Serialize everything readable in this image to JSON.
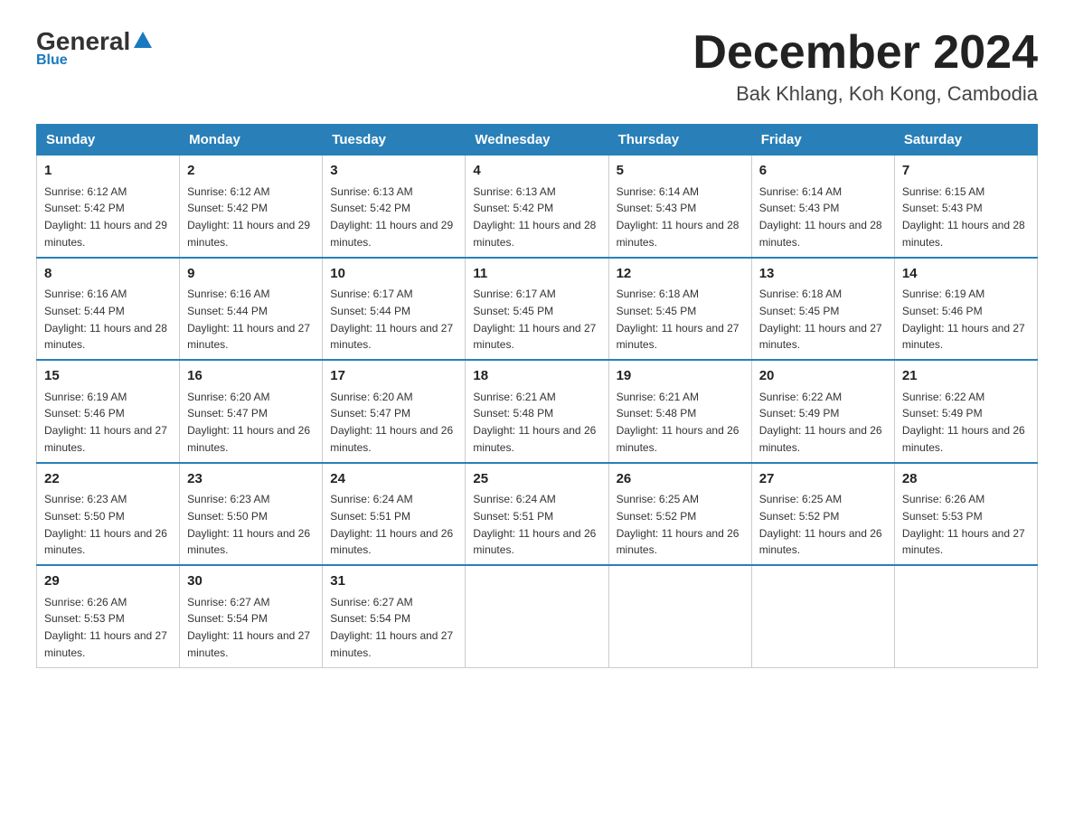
{
  "header": {
    "logo_general": "General",
    "logo_blue": "Blue",
    "month_title": "December 2024",
    "location": "Bak Khlang, Koh Kong, Cambodia"
  },
  "weekdays": [
    "Sunday",
    "Monday",
    "Tuesday",
    "Wednesday",
    "Thursday",
    "Friday",
    "Saturday"
  ],
  "weeks": [
    [
      {
        "day": "1",
        "sunrise": "6:12 AM",
        "sunset": "5:42 PM",
        "daylight": "11 hours and 29 minutes."
      },
      {
        "day": "2",
        "sunrise": "6:12 AM",
        "sunset": "5:42 PM",
        "daylight": "11 hours and 29 minutes."
      },
      {
        "day": "3",
        "sunrise": "6:13 AM",
        "sunset": "5:42 PM",
        "daylight": "11 hours and 29 minutes."
      },
      {
        "day": "4",
        "sunrise": "6:13 AM",
        "sunset": "5:42 PM",
        "daylight": "11 hours and 28 minutes."
      },
      {
        "day": "5",
        "sunrise": "6:14 AM",
        "sunset": "5:43 PM",
        "daylight": "11 hours and 28 minutes."
      },
      {
        "day": "6",
        "sunrise": "6:14 AM",
        "sunset": "5:43 PM",
        "daylight": "11 hours and 28 minutes."
      },
      {
        "day": "7",
        "sunrise": "6:15 AM",
        "sunset": "5:43 PM",
        "daylight": "11 hours and 28 minutes."
      }
    ],
    [
      {
        "day": "8",
        "sunrise": "6:16 AM",
        "sunset": "5:44 PM",
        "daylight": "11 hours and 28 minutes."
      },
      {
        "day": "9",
        "sunrise": "6:16 AM",
        "sunset": "5:44 PM",
        "daylight": "11 hours and 27 minutes."
      },
      {
        "day": "10",
        "sunrise": "6:17 AM",
        "sunset": "5:44 PM",
        "daylight": "11 hours and 27 minutes."
      },
      {
        "day": "11",
        "sunrise": "6:17 AM",
        "sunset": "5:45 PM",
        "daylight": "11 hours and 27 minutes."
      },
      {
        "day": "12",
        "sunrise": "6:18 AM",
        "sunset": "5:45 PM",
        "daylight": "11 hours and 27 minutes."
      },
      {
        "day": "13",
        "sunrise": "6:18 AM",
        "sunset": "5:45 PM",
        "daylight": "11 hours and 27 minutes."
      },
      {
        "day": "14",
        "sunrise": "6:19 AM",
        "sunset": "5:46 PM",
        "daylight": "11 hours and 27 minutes."
      }
    ],
    [
      {
        "day": "15",
        "sunrise": "6:19 AM",
        "sunset": "5:46 PM",
        "daylight": "11 hours and 27 minutes."
      },
      {
        "day": "16",
        "sunrise": "6:20 AM",
        "sunset": "5:47 PM",
        "daylight": "11 hours and 26 minutes."
      },
      {
        "day": "17",
        "sunrise": "6:20 AM",
        "sunset": "5:47 PM",
        "daylight": "11 hours and 26 minutes."
      },
      {
        "day": "18",
        "sunrise": "6:21 AM",
        "sunset": "5:48 PM",
        "daylight": "11 hours and 26 minutes."
      },
      {
        "day": "19",
        "sunrise": "6:21 AM",
        "sunset": "5:48 PM",
        "daylight": "11 hours and 26 minutes."
      },
      {
        "day": "20",
        "sunrise": "6:22 AM",
        "sunset": "5:49 PM",
        "daylight": "11 hours and 26 minutes."
      },
      {
        "day": "21",
        "sunrise": "6:22 AM",
        "sunset": "5:49 PM",
        "daylight": "11 hours and 26 minutes."
      }
    ],
    [
      {
        "day": "22",
        "sunrise": "6:23 AM",
        "sunset": "5:50 PM",
        "daylight": "11 hours and 26 minutes."
      },
      {
        "day": "23",
        "sunrise": "6:23 AM",
        "sunset": "5:50 PM",
        "daylight": "11 hours and 26 minutes."
      },
      {
        "day": "24",
        "sunrise": "6:24 AM",
        "sunset": "5:51 PM",
        "daylight": "11 hours and 26 minutes."
      },
      {
        "day": "25",
        "sunrise": "6:24 AM",
        "sunset": "5:51 PM",
        "daylight": "11 hours and 26 minutes."
      },
      {
        "day": "26",
        "sunrise": "6:25 AM",
        "sunset": "5:52 PM",
        "daylight": "11 hours and 26 minutes."
      },
      {
        "day": "27",
        "sunrise": "6:25 AM",
        "sunset": "5:52 PM",
        "daylight": "11 hours and 26 minutes."
      },
      {
        "day": "28",
        "sunrise": "6:26 AM",
        "sunset": "5:53 PM",
        "daylight": "11 hours and 27 minutes."
      }
    ],
    [
      {
        "day": "29",
        "sunrise": "6:26 AM",
        "sunset": "5:53 PM",
        "daylight": "11 hours and 27 minutes."
      },
      {
        "day": "30",
        "sunrise": "6:27 AM",
        "sunset": "5:54 PM",
        "daylight": "11 hours and 27 minutes."
      },
      {
        "day": "31",
        "sunrise": "6:27 AM",
        "sunset": "5:54 PM",
        "daylight": "11 hours and 27 minutes."
      },
      null,
      null,
      null,
      null
    ]
  ]
}
